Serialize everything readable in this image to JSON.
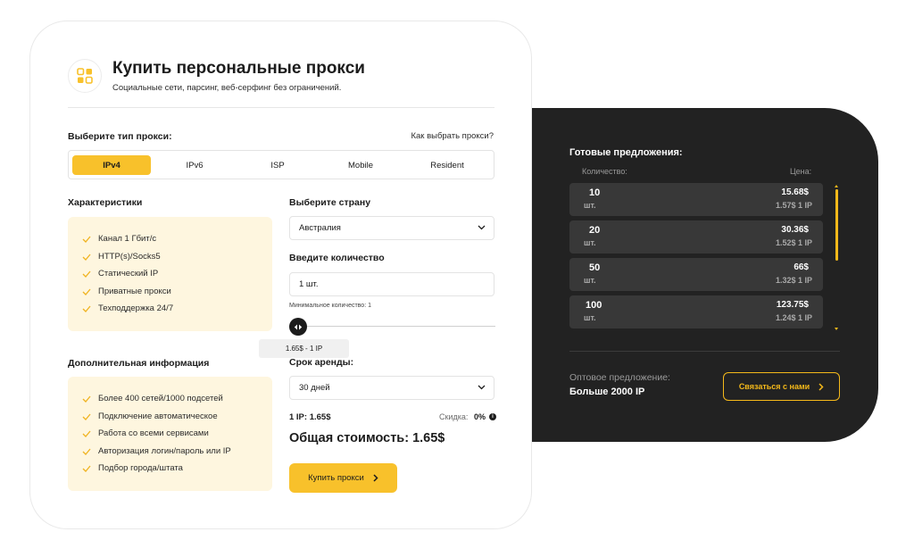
{
  "header": {
    "title": "Купить персональные прокси",
    "subtitle": "Социальные сети, парсинг, веб-серфинг без ограничений."
  },
  "proxy_type": {
    "label": "Выберите тип прокси:",
    "help_link": "Как выбрать прокси?",
    "tabs": [
      "IPv4",
      "IPv6",
      "ISP",
      "Mobile",
      "Resident"
    ],
    "active": "IPv4"
  },
  "characteristics": {
    "title": "Характеристики",
    "items": [
      "Канал 1 Гбит/с",
      "HTTP(s)/Socks5",
      "Статический IP",
      "Приватные прокси",
      "Техподдержка 24/7"
    ]
  },
  "additional": {
    "title": "Дополнительная информация",
    "items": [
      "Более 400 сетей/1000 подсетей",
      "Подключение автоматическое",
      "Работа со всеми сервисами",
      "Авторизация логин/пароль или IP",
      "Подбор города/штата"
    ]
  },
  "country": {
    "label": "Выберите страну",
    "value": "Австралия"
  },
  "quantity": {
    "label": "Введите количество",
    "value": "1 шт.",
    "hint": "Минимальное количество: 1",
    "slider_value": 0,
    "tooltip": "1.65$ - 1 IP"
  },
  "rent": {
    "label": "Срок аренды:",
    "value": "30 дней"
  },
  "summary": {
    "price_per_ip": "1 IP: 1.65$",
    "discount_label": "Скидка:",
    "discount_value": "0%",
    "info_glyph": "i",
    "total": "Общая стоимость: 1.65$"
  },
  "buy_button": "Купить прокси",
  "offers": {
    "title": "Готовые предложения:",
    "col_qty": "Количество:",
    "col_price": "Цена:",
    "items": [
      {
        "qty": "10",
        "unit": "шт.",
        "price": "15.68$",
        "per_ip": "1.57$ 1 IP"
      },
      {
        "qty": "20",
        "unit": "шт.",
        "price": "30.36$",
        "per_ip": "1.52$ 1 IP"
      },
      {
        "qty": "50",
        "unit": "шт.",
        "price": "66$",
        "per_ip": "1.32$ 1 IP"
      },
      {
        "qty": "100",
        "unit": "шт.",
        "price": "123.75$",
        "per_ip": "1.24$ 1 IP"
      }
    ],
    "wholesale_label": "Оптовое предложение:",
    "wholesale_value": "Больше 2000 IP",
    "contact_button": "Связаться с нами"
  },
  "colors": {
    "accent": "#f8c12b",
    "dark_panel": "#222222",
    "info_box": "#fef6df"
  }
}
